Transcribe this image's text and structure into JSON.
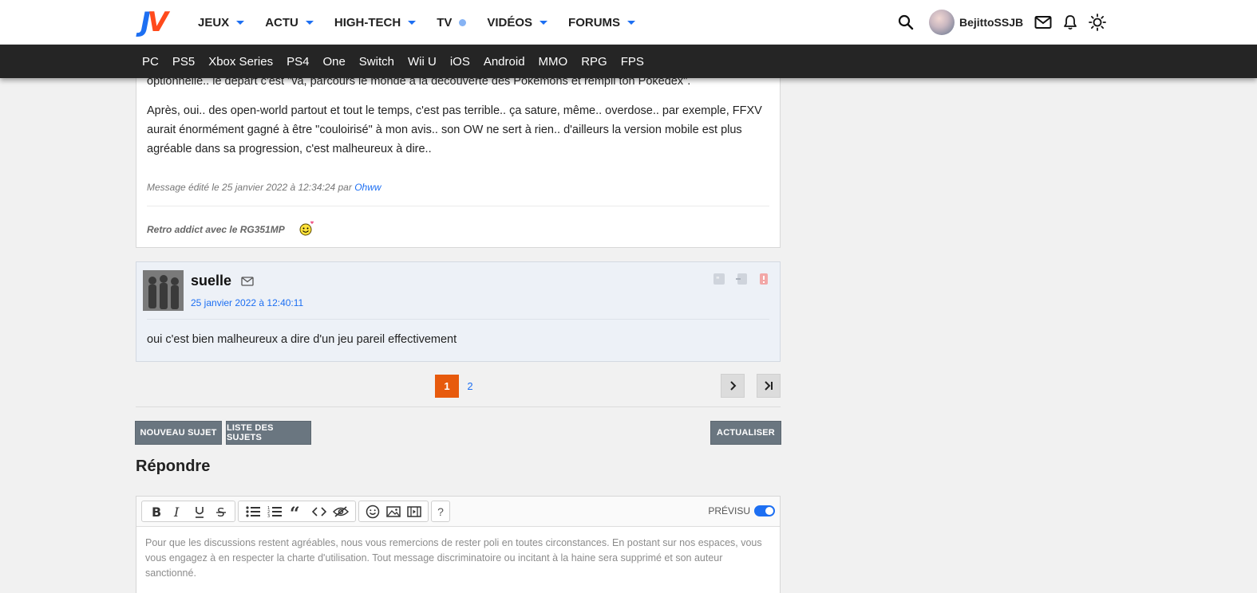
{
  "header": {
    "logo_j": "J",
    "logo_v": "V",
    "nav": [
      {
        "label": "JEUX",
        "marker": "caret"
      },
      {
        "label": "ACTU",
        "marker": "caret"
      },
      {
        "label": "HIGH-TECH",
        "marker": "caret"
      },
      {
        "label": "TV",
        "marker": "dot"
      },
      {
        "label": "VIDÉOS",
        "marker": "caret"
      },
      {
        "label": "FORUMS",
        "marker": "caret"
      }
    ],
    "username": "BejittoSSJB",
    "icons": [
      "search-icon",
      "mail-icon",
      "bell-icon",
      "sun-icon"
    ]
  },
  "subnav": [
    "PC",
    "PS5",
    "Xbox Series",
    "PS4",
    "One",
    "Switch",
    "Wii U",
    "iOS",
    "Android",
    "MMO",
    "RPG",
    "FPS"
  ],
  "post1": {
    "text1": "optionnelle.. le départ c'est \"va, parcours le monde à la découverte des Pokemons et rempli ton Pokedex\".",
    "text2": "Après, oui.. des open-world partout et tout le temps, c'est pas terrible.. ça sature, même.. overdose.. par exemple, FFXV aurait énormément gagné à être \"couloirisé\" à mon avis.. son OW ne sert à rien.. d'ailleurs la version mobile est plus agréable dans sa progression, c'est malheureux à dire..",
    "edited_prefix": "Message édité le 25 janvier 2022 à 12:34:24 par ",
    "edited_by": "Ohww",
    "signature": "Retro addict avec le RG351MP"
  },
  "post2": {
    "author": "suelle",
    "date": "25 janvier 2022 à 12:40:11",
    "message": "oui c'est bien malheureux a dire d'un jeu pareil effectivement"
  },
  "pagination": {
    "current": "1",
    "next_page": "2"
  },
  "buttons": {
    "new_topic": "NOUVEAU SUJET",
    "topic_list": "LISTE DES SUJETS",
    "refresh": "ACTUALISER"
  },
  "reply": {
    "title": "Répondre",
    "preview_label": "PRÉVISU",
    "help": "?",
    "placeholder": "Pour que les discussions restent agréables, nous vous remercions de rester poli en toutes circonstances. En postant sur nos espaces, vous vous engagez à en respecter la charte d'utilisation. Tout message discriminatoire ou incitant à la haine sera supprimé et son auteur sanctionné."
  },
  "colors": {
    "accent": "#1d6ff2",
    "current_page": "#e75a0d",
    "subnav_bg": "#252525",
    "button": "#6a7680"
  }
}
